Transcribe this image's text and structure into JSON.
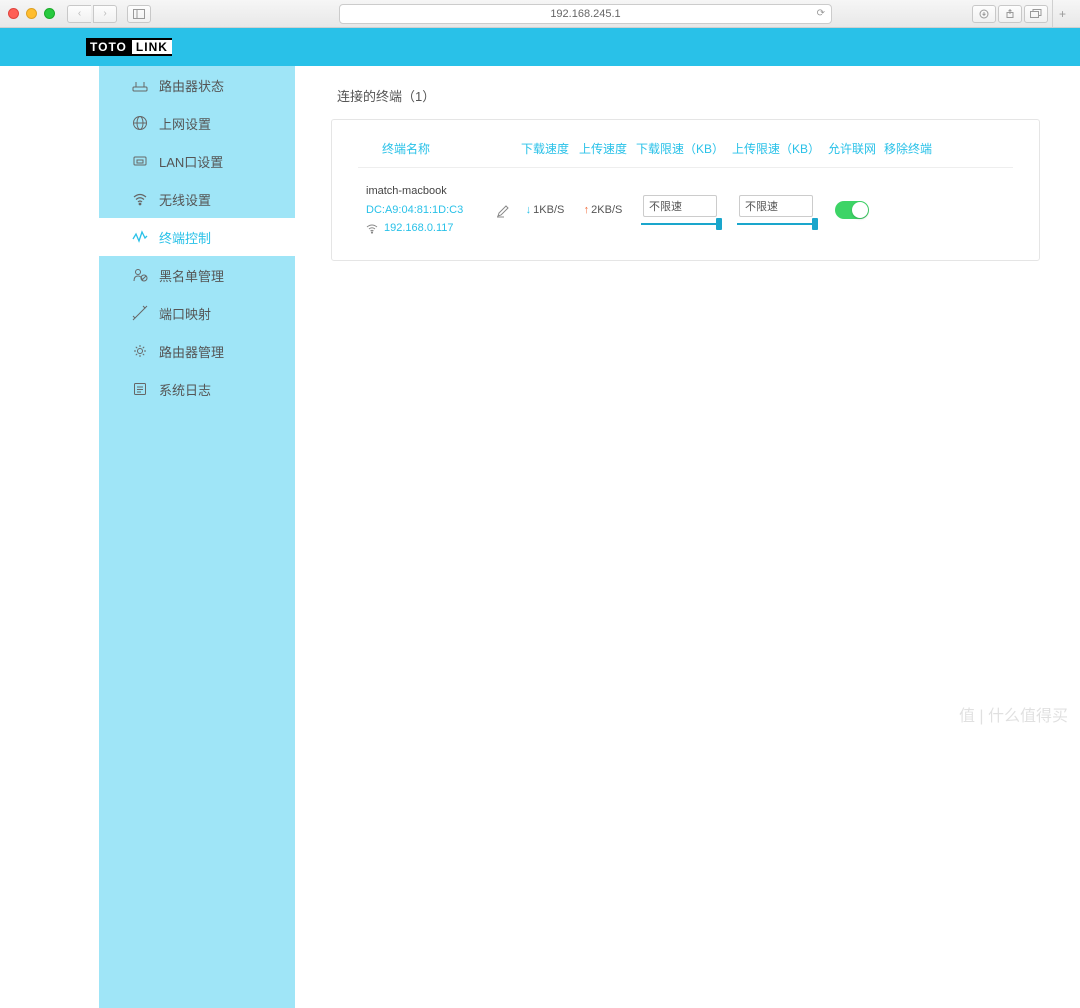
{
  "browser": {
    "url": "192.168.245.1"
  },
  "logo": {
    "left": "TOTO",
    "right": "LINK"
  },
  "sidebar": {
    "items": [
      {
        "label": "路由器状态"
      },
      {
        "label": "上网设置"
      },
      {
        "label": "LAN口设置"
      },
      {
        "label": "无线设置"
      },
      {
        "label": "终端控制"
      },
      {
        "label": "黑名单管理"
      },
      {
        "label": "端口映射"
      },
      {
        "label": "路由器管理"
      },
      {
        "label": "系统日志"
      }
    ]
  },
  "section": {
    "title": "连接的终端（1）"
  },
  "columns": {
    "name": "终端名称",
    "dl": "下载速度",
    "ul": "上传速度",
    "dlimit": "下载限速（KB）",
    "ulimit": "上传限速（KB）",
    "allow": "允许联网",
    "remove": "移除终端"
  },
  "device": {
    "name": "imatch-macbook",
    "mac": "DC:A9:04:81:1D:C3",
    "ip": "192.168.0.117",
    "dl_speed": "1KB/S",
    "ul_speed": "2KB/S",
    "dl_limit": "不限速",
    "ul_limit": "不限速"
  },
  "watermark": "值 | 什么值得买"
}
